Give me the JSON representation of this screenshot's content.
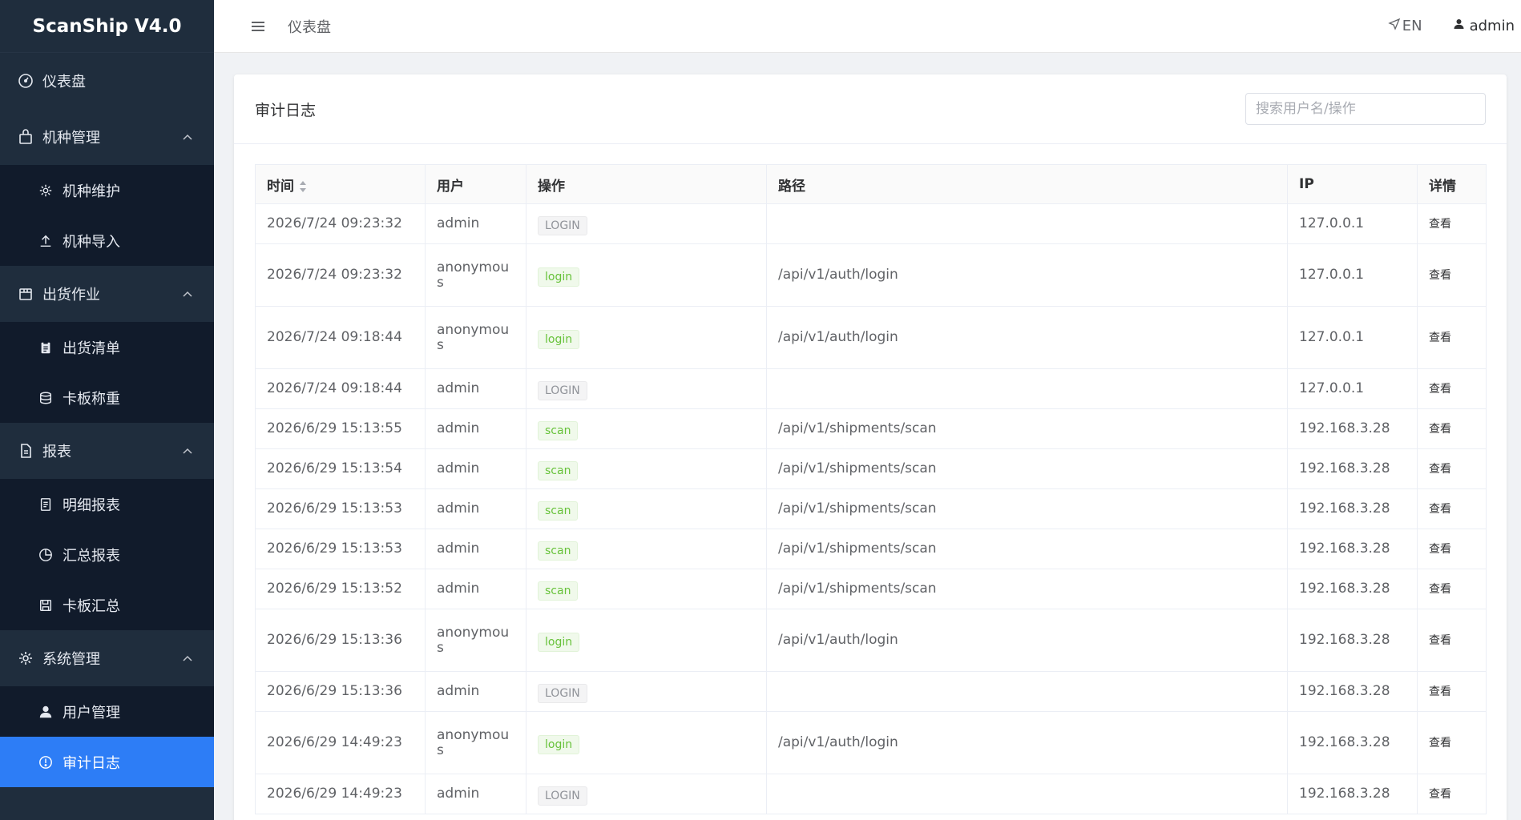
{
  "brand": "ScanShip V4.0",
  "sidebar": {
    "dashboard": "仪表盘",
    "groups": [
      {
        "label": "机种管理",
        "icon": "bag-icon",
        "items": [
          "机种维护",
          "机种导入"
        ]
      },
      {
        "label": "出货作业",
        "icon": "box-icon",
        "items": [
          "出货清单",
          "卡板称重"
        ]
      },
      {
        "label": "报表",
        "icon": "document-icon",
        "items": [
          "明细报表",
          "汇总报表",
          "卡板汇总"
        ]
      },
      {
        "label": "系统管理",
        "icon": "gear-icon",
        "items": [
          "用户管理",
          "审计日志"
        ]
      }
    ]
  },
  "topbar": {
    "breadcrumb": "仪表盘",
    "lang": "EN",
    "user": "admin"
  },
  "card": {
    "title": "审计日志",
    "search_placeholder": "搜索用户名/操作"
  },
  "table": {
    "columns": [
      "时间",
      "用户",
      "操作",
      "路径",
      "IP",
      "详情"
    ],
    "rows": [
      {
        "time": "2026/7/24 09:23:32",
        "user": "admin",
        "action": "LOGIN",
        "action_type": "gray",
        "path": "",
        "ip": "127.0.0.1",
        "detail": "查看"
      },
      {
        "time": "2026/7/24 09:23:32",
        "user": "anonymous",
        "action": "login",
        "action_type": "green",
        "path": "/api/v1/auth/login",
        "ip": "127.0.0.1",
        "detail": "查看"
      },
      {
        "time": "2026/7/24 09:18:44",
        "user": "anonymous",
        "action": "login",
        "action_type": "green",
        "path": "/api/v1/auth/login",
        "ip": "127.0.0.1",
        "detail": "查看"
      },
      {
        "time": "2026/7/24 09:18:44",
        "user": "admin",
        "action": "LOGIN",
        "action_type": "gray",
        "path": "",
        "ip": "127.0.0.1",
        "detail": "查看"
      },
      {
        "time": "2026/6/29 15:13:55",
        "user": "admin",
        "action": "scan",
        "action_type": "green",
        "path": "/api/v1/shipments/scan",
        "ip": "192.168.3.28",
        "detail": "查看"
      },
      {
        "time": "2026/6/29 15:13:54",
        "user": "admin",
        "action": "scan",
        "action_type": "green",
        "path": "/api/v1/shipments/scan",
        "ip": "192.168.3.28",
        "detail": "查看"
      },
      {
        "time": "2026/6/29 15:13:53",
        "user": "admin",
        "action": "scan",
        "action_type": "green",
        "path": "/api/v1/shipments/scan",
        "ip": "192.168.3.28",
        "detail": "查看"
      },
      {
        "time": "2026/6/29 15:13:53",
        "user": "admin",
        "action": "scan",
        "action_type": "green",
        "path": "/api/v1/shipments/scan",
        "ip": "192.168.3.28",
        "detail": "查看"
      },
      {
        "time": "2026/6/29 15:13:52",
        "user": "admin",
        "action": "scan",
        "action_type": "green",
        "path": "/api/v1/shipments/scan",
        "ip": "192.168.3.28",
        "detail": "查看"
      },
      {
        "time": "2026/6/29 15:13:36",
        "user": "anonymous",
        "action": "login",
        "action_type": "green",
        "path": "/api/v1/auth/login",
        "ip": "192.168.3.28",
        "detail": "查看"
      },
      {
        "time": "2026/6/29 15:13:36",
        "user": "admin",
        "action": "LOGIN",
        "action_type": "gray",
        "path": "",
        "ip": "192.168.3.28",
        "detail": "查看"
      },
      {
        "time": "2026/6/29 14:49:23",
        "user": "anonymous",
        "action": "login",
        "action_type": "green",
        "path": "/api/v1/auth/login",
        "ip": "192.168.3.28",
        "detail": "查看"
      },
      {
        "time": "2026/6/29 14:49:23",
        "user": "admin",
        "action": "LOGIN",
        "action_type": "gray",
        "path": "",
        "ip": "192.168.3.28",
        "detail": "查看"
      }
    ]
  },
  "colors": {
    "sidebar_bg": "#1f2d3d",
    "submenu_bg": "#111b2b",
    "active": "#2d7df6",
    "tag_green": "#67c23a",
    "tag_gray": "#909399"
  }
}
